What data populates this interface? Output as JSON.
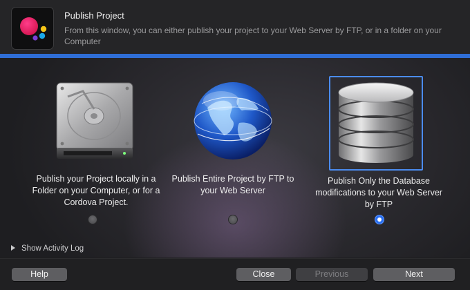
{
  "header": {
    "title": "Publish Project",
    "description": "From this window, you can either publish your project to your Web Server by FTP, or in a folder on your Computer"
  },
  "options": [
    {
      "label": "Publish your Project locally in a Folder on your Computer, or for a Cordova Project.",
      "icon": "hard-drive-icon",
      "selected": false
    },
    {
      "label": "Publish Entire Project by FTP to your Web Server",
      "icon": "globe-icon",
      "selected": false
    },
    {
      "label": "Publish Only the Database modifications to your Web Server by FTP",
      "icon": "database-icon",
      "selected": true
    }
  ],
  "activity_log": {
    "label": "Show Activity Log"
  },
  "footer": {
    "help": "Help",
    "close": "Close",
    "previous": "Previous",
    "next": "Next"
  },
  "colors": {
    "accent": "#2f6ed6",
    "selection": "#4b8cf0"
  }
}
